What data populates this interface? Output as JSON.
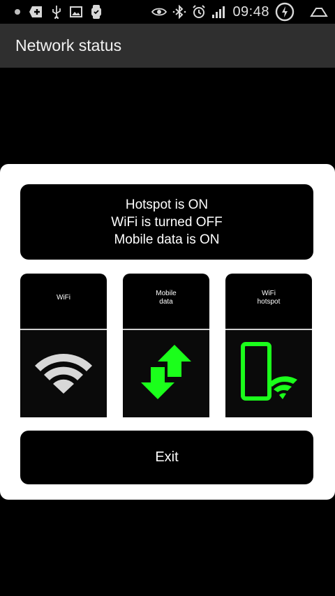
{
  "status_bar": {
    "time": "09:48",
    "left_icons": [
      "notification-dot-icon",
      "add-box-icon",
      "usb-icon",
      "image-icon",
      "watch-icon"
    ],
    "right_icons": [
      "eye-icon",
      "bluetooth-icon",
      "alarm-icon",
      "signal-icon",
      "charging-icon",
      "home-shape-icon"
    ]
  },
  "action_bar": {
    "title": "Network status"
  },
  "dialog": {
    "status_lines": [
      "Hotspot is ON",
      "WiFi is turned OFF",
      "Mobile data is ON"
    ],
    "tiles": [
      {
        "label": "WiFi",
        "icon": "wifi-icon",
        "color": "#d8d8d8"
      },
      {
        "label_lines": [
          "Mobile",
          "data"
        ],
        "icon": "mobile-data-arrows-icon",
        "color": "#1bff1b"
      },
      {
        "label_lines": [
          "WiFi",
          "hotspot"
        ],
        "icon": "hotspot-phone-icon",
        "color": "#1bff1b"
      }
    ],
    "exit_label": "Exit"
  },
  "colors": {
    "action_bar_bg": "#2f2f2f",
    "accent_green": "#1bff1b",
    "wifi_gray": "#d8d8d8"
  }
}
